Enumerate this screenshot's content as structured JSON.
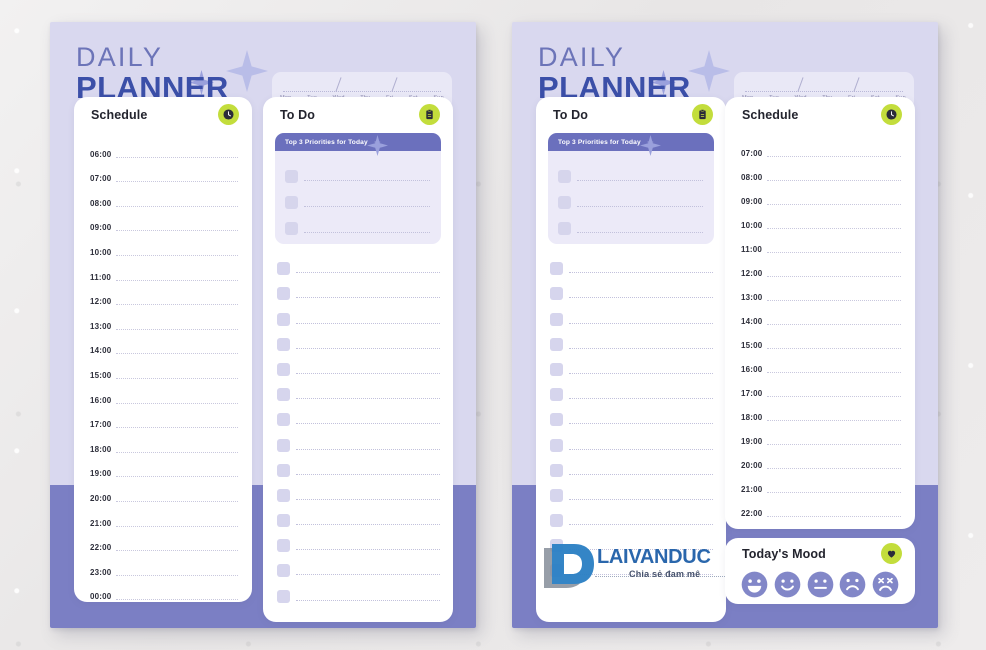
{
  "backdrop": {
    "color": "#eceaea"
  },
  "theme": {
    "page_bg": "#d9d8ef",
    "page_band": "#7b7fc4",
    "accent_lime": "#c3dd3c",
    "title_blue": "#3b4fa8",
    "title_light": "#6c74b8",
    "priority_bar": "#6b70bd",
    "checkbox": "#d6d5ed",
    "mood_face": "#8287c8"
  },
  "brand": {
    "line1": "DAILY",
    "line2": "PLANNER"
  },
  "date_strip": {
    "days": [
      "Mon",
      "Tue",
      "Wed",
      "Thu",
      "Fri",
      "Sat",
      "Sun"
    ]
  },
  "left_page": {
    "schedule": {
      "title": "Schedule",
      "icon": "clock-icon",
      "times": [
        "06:00",
        "07:00",
        "08:00",
        "09:00",
        "10:00",
        "11:00",
        "12:00",
        "13:00",
        "14:00",
        "15:00",
        "16:00",
        "17:00",
        "18:00",
        "19:00",
        "20:00",
        "21:00",
        "22:00",
        "23:00",
        "00:00"
      ]
    },
    "todo": {
      "title": "To Do",
      "icon": "clipboard-icon",
      "priorities_label": "Top 3 Priorities for Today",
      "priority_count": 3,
      "item_count": 14
    }
  },
  "right_page": {
    "todo": {
      "title": "To Do",
      "icon": "clipboard-icon",
      "priorities_label": "Top 3 Priorities for Today",
      "priority_count": 3,
      "item_count": 13
    },
    "schedule": {
      "title": "Schedule",
      "icon": "clock-icon",
      "times": [
        "07:00",
        "08:00",
        "09:00",
        "10:00",
        "11:00",
        "12:00",
        "13:00",
        "14:00",
        "15:00",
        "16:00",
        "17:00",
        "18:00",
        "19:00",
        "20:00",
        "21:00",
        "22:00"
      ]
    },
    "mood": {
      "title": "Today's Mood",
      "icon": "heart-icon",
      "faces": [
        "grin-face",
        "smile-face",
        "neutral-face",
        "sad-face",
        "distressed-face"
      ]
    }
  },
  "watermark": {
    "name": "LAIVANDUC",
    "tagline": "Chia sẻ đam mê"
  }
}
